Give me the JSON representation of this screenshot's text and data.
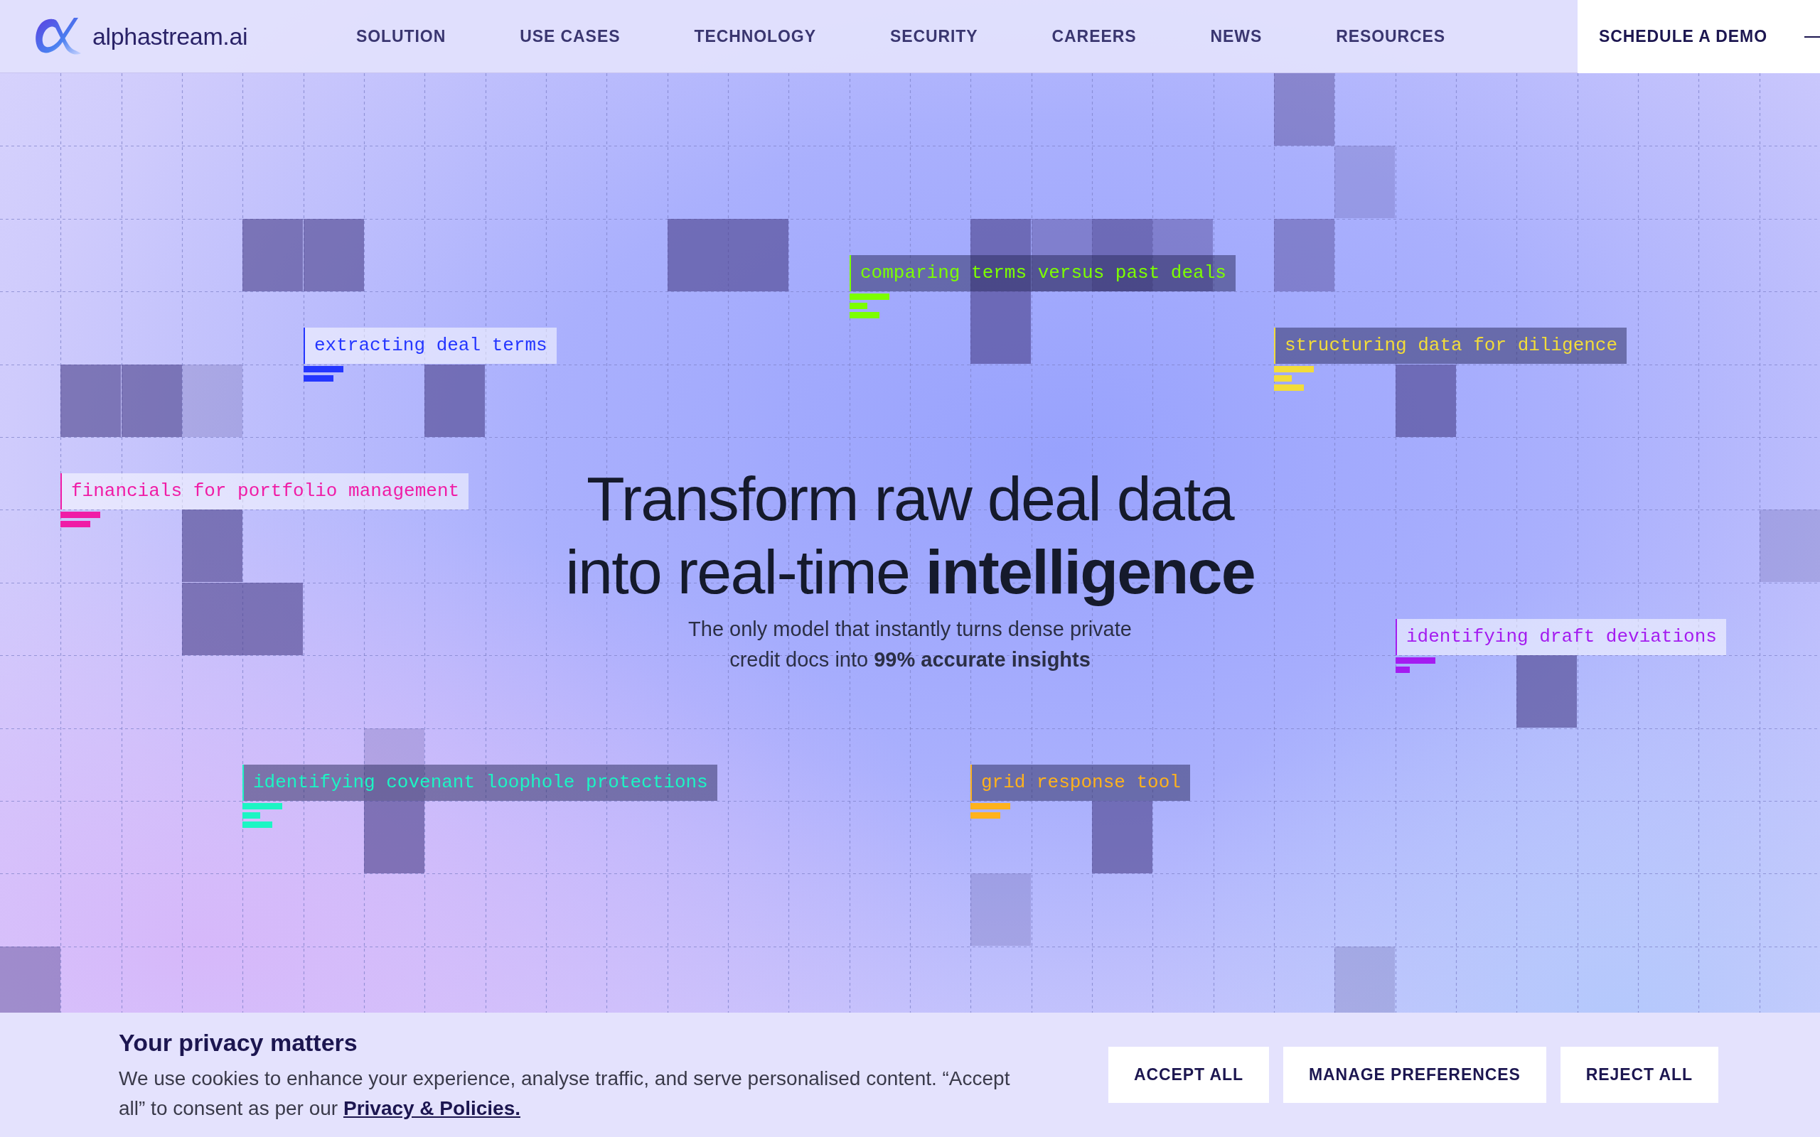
{
  "header": {
    "logo_text": "alphastream.ai",
    "nav": [
      "SOLUTION",
      "USE CASES",
      "TECHNOLOGY",
      "SECURITY",
      "CAREERS",
      "NEWS",
      "RESOURCES"
    ],
    "cta": "SCHEDULE A DEMO"
  },
  "tags": [
    {
      "text": "comparing terms versus past deals",
      "color": "#7cff00"
    },
    {
      "text": "extracting deal terms",
      "color": "#2436ff"
    },
    {
      "text": "structuring data for diligence",
      "color": "#f2dc3a"
    },
    {
      "text": "financials for portfolio management",
      "color": "#f01ca6"
    },
    {
      "text": "identifying draft deviations",
      "color": "#a41cf0"
    },
    {
      "text": "identifying covenant loophole protections",
      "color": "#1cf5c4"
    },
    {
      "text": "grid response tool",
      "color": "#ffb21c"
    }
  ],
  "hero": {
    "title_lines": [
      "Transform raw deal data",
      "into real-time **intelligence**"
    ],
    "subtitle_lines": [
      "The only model that instantly turns dense private",
      "credit docs into **99% accurate insights**"
    ]
  },
  "cookie_banner": {
    "title": "Your privacy matters",
    "body": "We use cookies to enhance your experience, analyse traffic, and serve personalised content. “Accept all” to consent as per our ",
    "link": "Privacy & Policies.",
    "buttons": [
      "ACCEPT ALL",
      "MANAGE PREFERENCES",
      "REJECT ALL"
    ]
  }
}
